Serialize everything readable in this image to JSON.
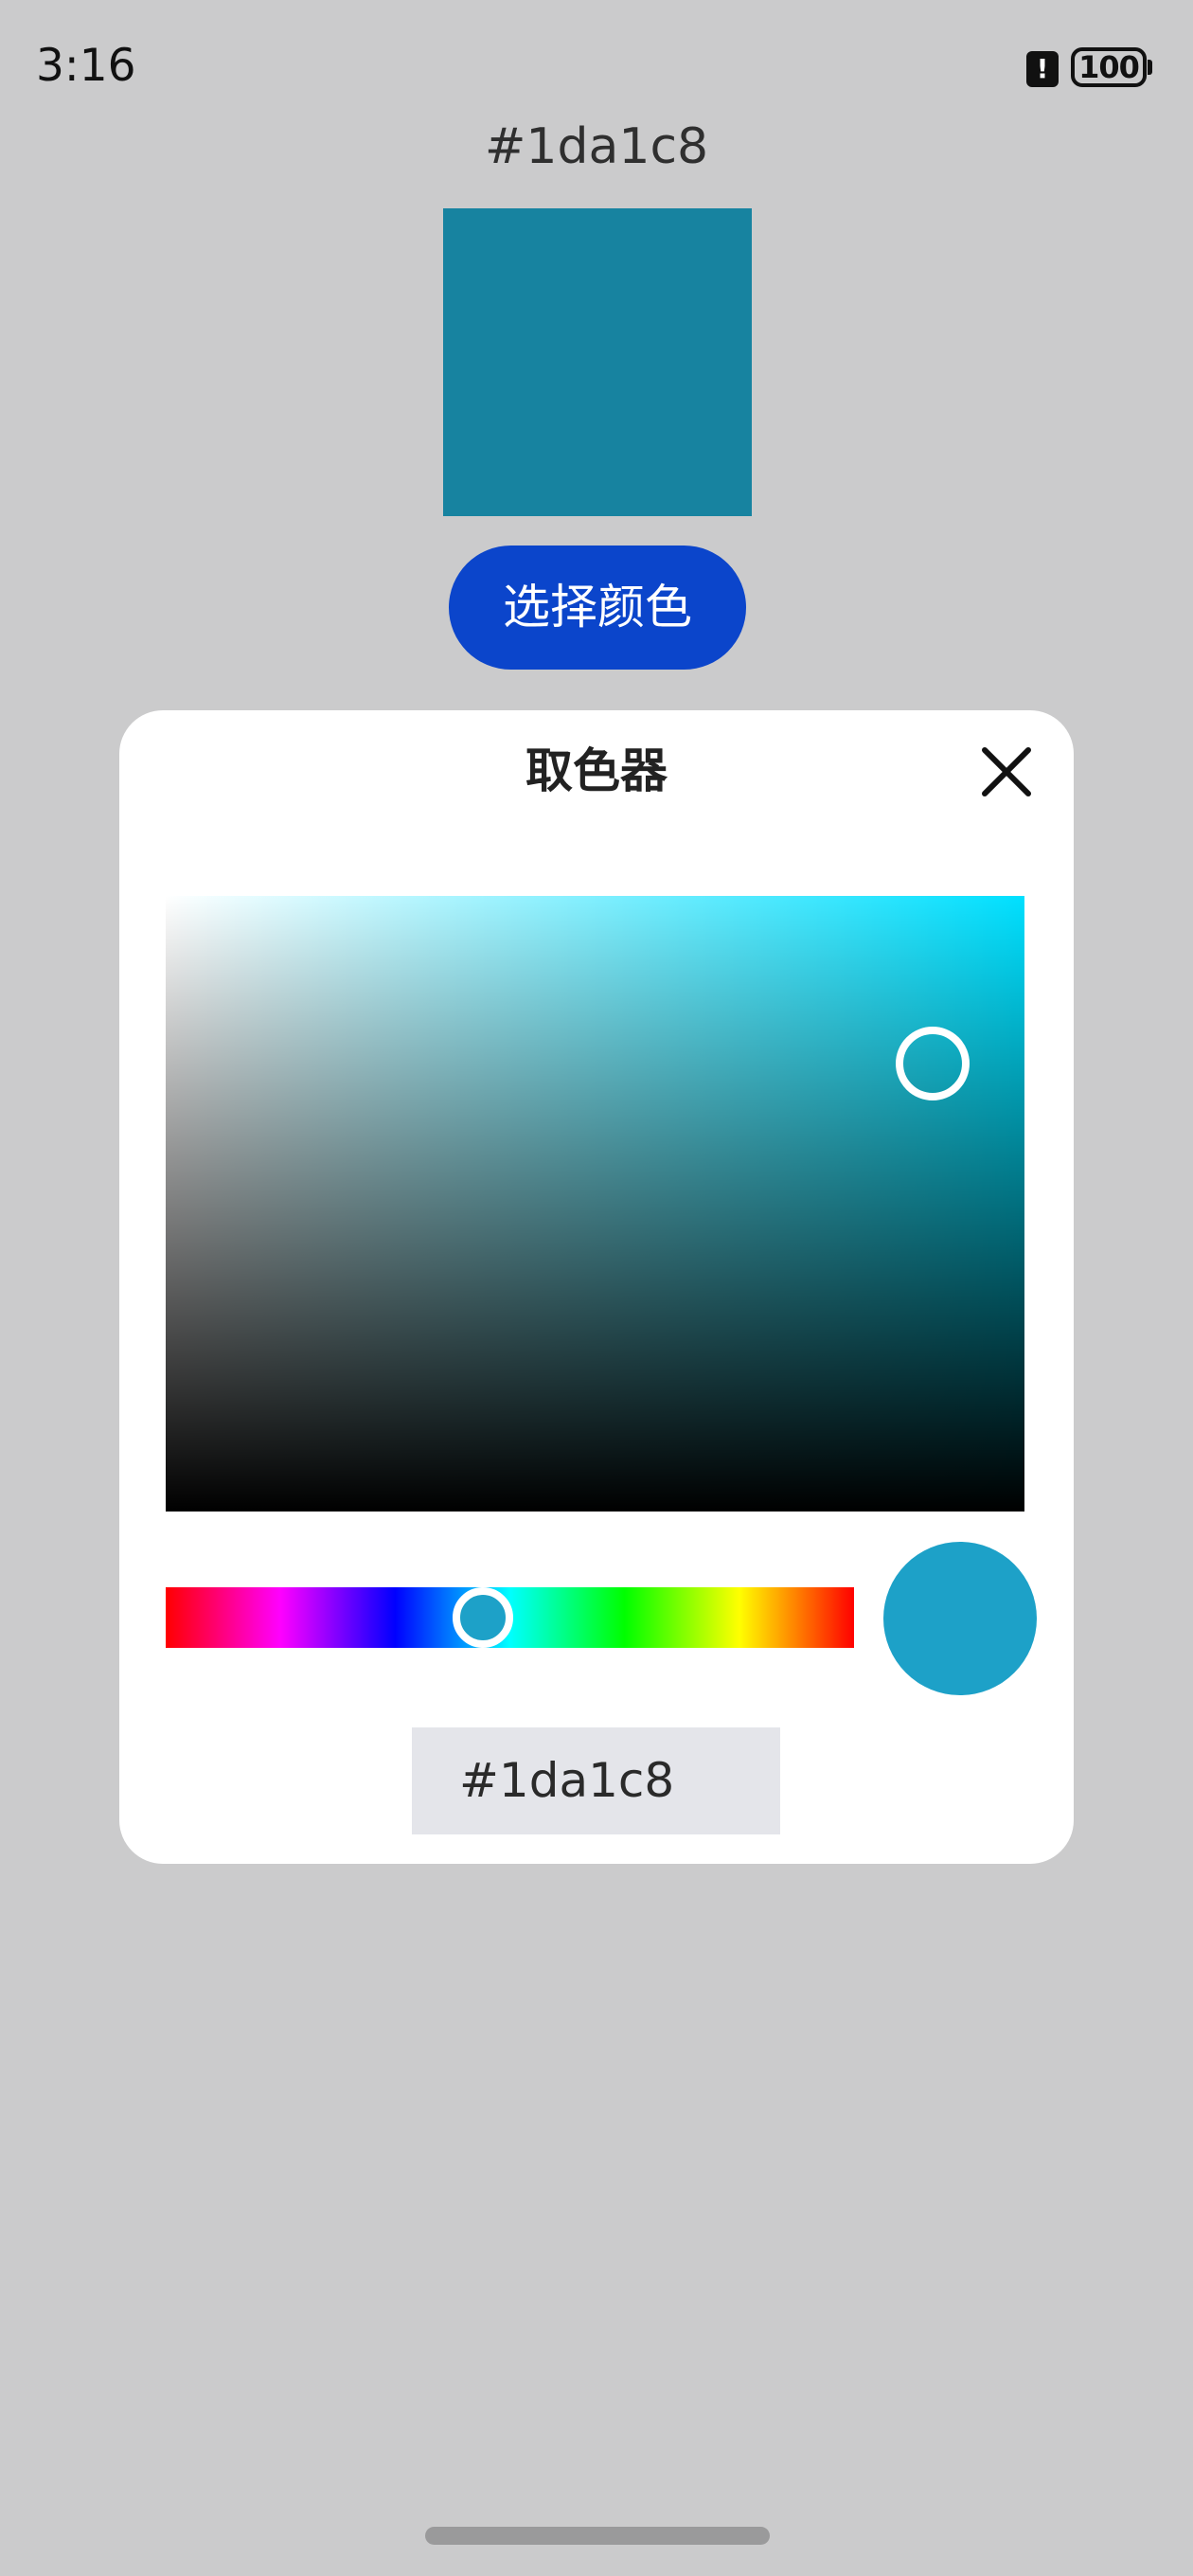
{
  "status_bar": {
    "time": "3:16",
    "alert_glyph": "!",
    "battery_level": "100"
  },
  "preview": {
    "hex_label": "#1da1c8",
    "swatch_color": "#1783a0",
    "choose_button_label": "选择颜色",
    "choose_button_color": "#0b45cb"
  },
  "dialog": {
    "title": "取色器",
    "close_icon": "close-icon",
    "saturation_value_field": {
      "hue_color": "#00e0ff",
      "handle_saturation": 0.85,
      "handle_value": 0.82
    },
    "hue_slider": {
      "hue_fraction": 0.46
    },
    "result_color": "#1da1c8",
    "hex_input_value": "#1da1c8"
  }
}
